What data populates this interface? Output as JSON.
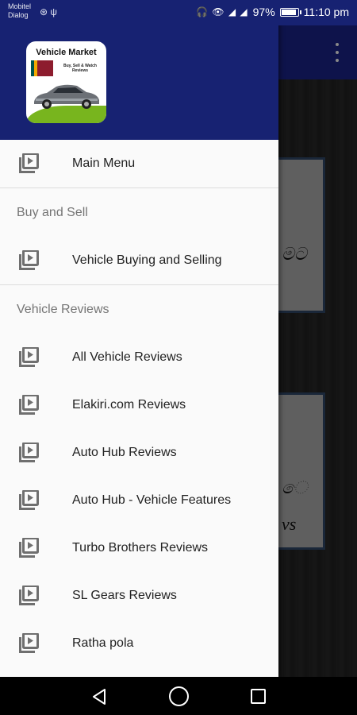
{
  "status_bar": {
    "carrier_line1": "Mobitel",
    "carrier_line2": "Dialog",
    "battery_text": "97%",
    "battery_level": 0.97,
    "time": "11:10 pm"
  },
  "background_screen": {
    "card1_text": "මට",
    "card2_text1": "ෙ",
    "card2_text2": "vs"
  },
  "drawer": {
    "logo": {
      "title": "Vehicle Market",
      "subtitle": "Buy, Sell & Watch Reviews"
    },
    "items": [
      {
        "label": "Main Menu",
        "icon": "video-library-icon"
      }
    ],
    "section_buy_sell": {
      "title": "Buy and Sell",
      "items": [
        {
          "label": "Vehicle Buying and Selling",
          "icon": "video-library-icon"
        }
      ]
    },
    "section_reviews": {
      "title": "Vehicle Reviews",
      "items": [
        {
          "label": "All Vehicle Reviews",
          "icon": "video-library-icon"
        },
        {
          "label": "Elakiri.com Reviews",
          "icon": "video-library-icon"
        },
        {
          "label": "Auto Hub Reviews",
          "icon": "video-library-icon"
        },
        {
          "label": "Auto Hub - Vehicle Features",
          "icon": "video-library-icon"
        },
        {
          "label": "Turbo Brothers Reviews",
          "icon": "video-library-icon"
        },
        {
          "label": "SL Gears Reviews",
          "icon": "video-library-icon"
        },
        {
          "label": "Ratha pola",
          "icon": "video-library-icon"
        }
      ]
    }
  },
  "nav_bar": {
    "back": "back-icon",
    "home": "home-icon",
    "recents": "recents-icon"
  },
  "colors": {
    "primary": "#172272",
    "drawer_bg": "#fafafa",
    "text_primary": "#212121",
    "text_secondary": "#757575",
    "icon_gray": "#6f6f6f"
  }
}
